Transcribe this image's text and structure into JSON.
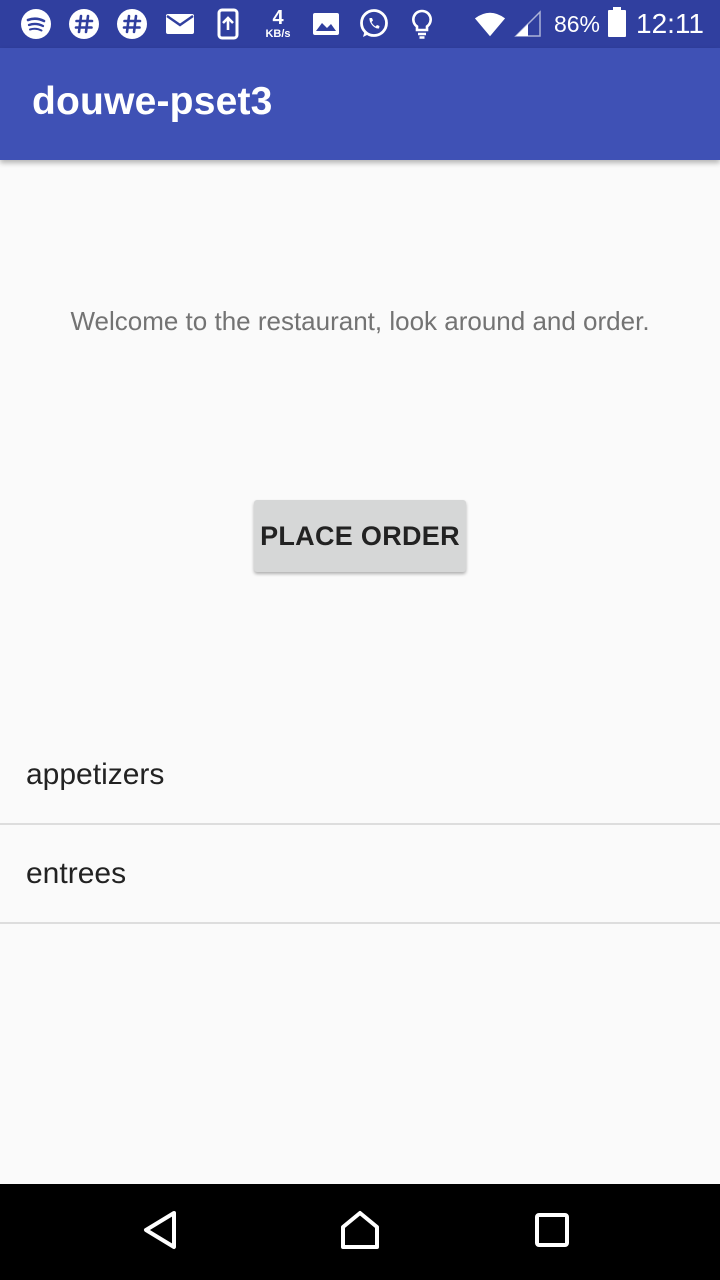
{
  "status_bar": {
    "net_speed_value": "4",
    "net_speed_unit": "KB/s",
    "battery_percent": "86%",
    "time": "12:11",
    "icons_left": [
      "spotify-icon",
      "hashtag-icon",
      "hashtag-icon",
      "mail-icon",
      "upload-icon",
      "image-icon",
      "whatsapp-icon",
      "lightbulb-icon"
    ],
    "icons_right": [
      "wifi-icon",
      "signal-icon",
      "battery-icon"
    ]
  },
  "app_bar": {
    "title": "douwe-pset3",
    "color": "#3f51b5",
    "status_color": "#303f9f"
  },
  "main": {
    "welcome": "Welcome to the restaurant, look around and order.",
    "place_order_label": "PLACE ORDER",
    "categories": [
      {
        "label": "appetizers"
      },
      {
        "label": "entrees"
      }
    ]
  },
  "nav_bar": {
    "buttons": [
      "back-icon",
      "home-icon",
      "recents-icon"
    ]
  }
}
